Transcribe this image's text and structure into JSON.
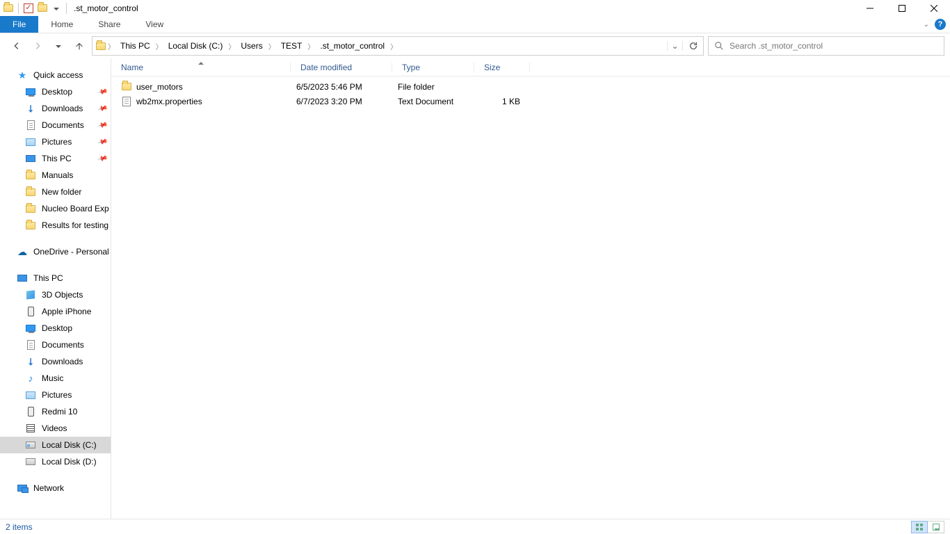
{
  "window": {
    "title": ".st_motor_control"
  },
  "ribbon": {
    "file": "File",
    "tabs": [
      "Home",
      "Share",
      "View"
    ]
  },
  "breadcrumb": {
    "items": [
      "This PC",
      "Local Disk (C:)",
      "Users",
      "TEST",
      ".st_motor_control"
    ]
  },
  "search": {
    "placeholder": "Search .st_motor_control"
  },
  "nav": {
    "quick_access": "Quick access",
    "quick_items": [
      {
        "label": "Desktop",
        "icon": "desktop",
        "pinned": true
      },
      {
        "label": "Downloads",
        "icon": "down",
        "pinned": true
      },
      {
        "label": "Documents",
        "icon": "doc",
        "pinned": true
      },
      {
        "label": "Pictures",
        "icon": "pic",
        "pinned": true
      },
      {
        "label": "This PC",
        "icon": "pc",
        "pinned": true
      },
      {
        "label": "Manuals",
        "icon": "folder"
      },
      {
        "label": "New folder",
        "icon": "folder"
      },
      {
        "label": "Nucleo Board Exp",
        "icon": "folder"
      },
      {
        "label": "Results for testing p",
        "icon": "folder"
      }
    ],
    "onedrive": "OneDrive - Personal",
    "this_pc": "This PC",
    "pc_items": [
      {
        "label": "3D Objects",
        "icon": "3d"
      },
      {
        "label": "Apple iPhone",
        "icon": "phone"
      },
      {
        "label": "Desktop",
        "icon": "desktop"
      },
      {
        "label": "Documents",
        "icon": "doc"
      },
      {
        "label": "Downloads",
        "icon": "down"
      },
      {
        "label": "Music",
        "icon": "music"
      },
      {
        "label": "Pictures",
        "icon": "pic"
      },
      {
        "label": "Redmi 10",
        "icon": "phone"
      },
      {
        "label": "Videos",
        "icon": "video"
      },
      {
        "label": "Local Disk (C:)",
        "icon": "diskc",
        "selected": true
      },
      {
        "label": "Local Disk (D:)",
        "icon": "disk"
      }
    ],
    "network": "Network"
  },
  "columns": {
    "name": "Name",
    "date": "Date modified",
    "type": "Type",
    "size": "Size"
  },
  "rows": [
    {
      "name": "user_motors",
      "date": "6/5/2023 5:46 PM",
      "type": "File folder",
      "size": "",
      "icon": "folder"
    },
    {
      "name": "wb2mx.properties",
      "date": "6/7/2023 3:20 PM",
      "type": "Text Document",
      "size": "1 KB",
      "icon": "txt"
    }
  ],
  "status": {
    "text": "2 items"
  }
}
